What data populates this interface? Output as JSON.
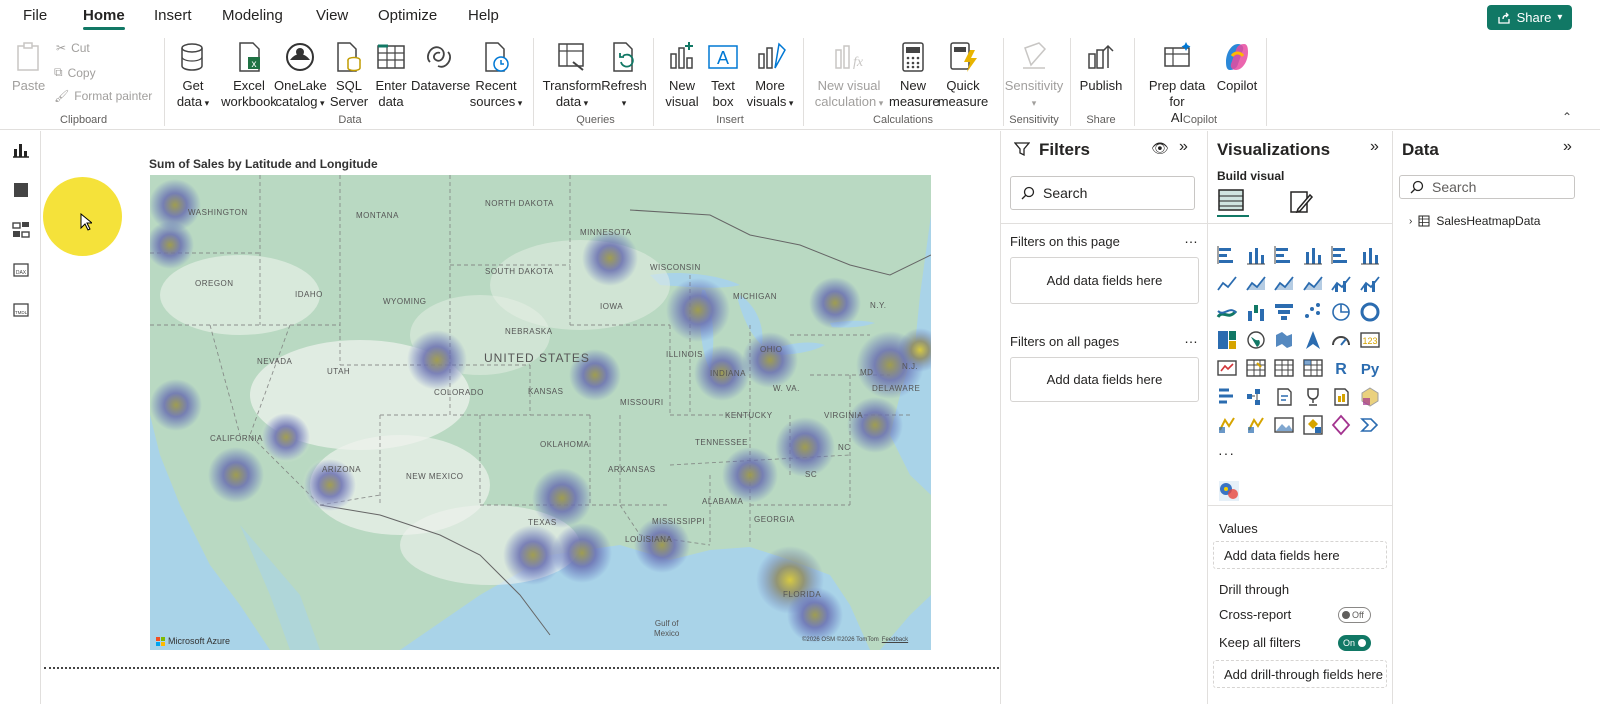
{
  "menubar": {
    "items": [
      "File",
      "Home",
      "Insert",
      "Modeling",
      "View",
      "Optimize",
      "Help"
    ],
    "active": "Home",
    "share_label": "Share"
  },
  "ribbon": {
    "clipboard": {
      "paste": "Paste",
      "cut": "Cut",
      "copy": "Copy",
      "format_painter": "Format painter",
      "group": "Clipboard"
    },
    "data": {
      "get_data": [
        "Get",
        "data"
      ],
      "excel": [
        "Excel",
        "workbook"
      ],
      "onelake": [
        "OneLake",
        "catalog"
      ],
      "sql": [
        "SQL",
        "Server"
      ],
      "enter": [
        "Enter",
        "data"
      ],
      "dataverse": [
        "Dataverse"
      ],
      "recent": [
        "Recent",
        "sources"
      ],
      "group": "Data"
    },
    "queries": {
      "transform": [
        "Transform",
        "data"
      ],
      "refresh": [
        "Refresh"
      ],
      "group": "Queries"
    },
    "insert": {
      "new_visual": [
        "New",
        "visual"
      ],
      "text_box": [
        "Text",
        "box"
      ],
      "more_visuals": [
        "More",
        "visuals"
      ],
      "group": "Insert"
    },
    "calculations": {
      "new_visual_calc": [
        "New visual",
        "calculation"
      ],
      "new_measure": [
        "New",
        "measure"
      ],
      "quick_measure": [
        "Quick",
        "measure"
      ],
      "group": "Calculations"
    },
    "sensitivity": {
      "label": [
        "Sensitivity"
      ],
      "group": "Sensitivity"
    },
    "share": {
      "publish": [
        "Publish"
      ],
      "group": "Share"
    },
    "copilot": {
      "prep": [
        "Prep data for",
        "AI"
      ],
      "copilot": [
        "Copilot"
      ],
      "group": "Copilot"
    }
  },
  "visual": {
    "title": "Sum of Sales by Latitude and Longitude",
    "map_labels": [
      "WASHINGTON",
      "MONTANA",
      "NORTH DAKOTA",
      "MINNESOTA",
      "OREGON",
      "IDAHO",
      "SOUTH DAKOTA",
      "WYOMING",
      "WISCONSIN",
      "MICHIGAN",
      "IOWA",
      "NEBRASKA",
      "UNITED STATES",
      "NEVADA",
      "UTAH",
      "COLORADO",
      "KANSAS",
      "MISSOURI",
      "ILLINOIS",
      "INDIANA",
      "OHIO",
      "CALIFORNIA",
      "ARIZONA",
      "NEW MEXICO",
      "OKLAHOMA",
      "ARKANSAS",
      "TENNESSEE",
      "KENTUCKY",
      "W. VA.",
      "VIRGINIA",
      "NC",
      "SC",
      "TEXAS",
      "LOUISIANA",
      "MISSISSIPPI",
      "ALABAMA",
      "GEORGIA",
      "FLORIDA",
      "N.Y.",
      "DELAWARE",
      "MD",
      "N.J."
    ],
    "gulf_label": [
      "Gulf of",
      "Mexico"
    ],
    "attribution_logo": "Microsoft Azure",
    "attribution_text": "©2026 OSM ©2026 TomTom",
    "feedback": "Feedback"
  },
  "filters": {
    "title": "Filters",
    "search_placeholder": "Search",
    "on_this_page": "Filters on this page",
    "on_all_pages": "Filters on all pages",
    "add_fields": "Add data fields here"
  },
  "visualizations": {
    "title": "Visualizations",
    "build_visual": "Build visual",
    "values": "Values",
    "values_placeholder": "Add data fields here",
    "drill_through": "Drill through",
    "cross_report": "Cross-report",
    "cross_report_state": "Off",
    "keep_all_filters": "Keep all filters",
    "keep_all_filters_state": "On",
    "drill_placeholder": "Add drill-through fields here",
    "more": "···"
  },
  "data_pane": {
    "title": "Data",
    "search_placeholder": "Search",
    "table_name": "SalesHeatmapData"
  },
  "colors": {
    "accent": "#117865",
    "heat": "#5b6bbf",
    "map_land": "#b7d8c1"
  }
}
